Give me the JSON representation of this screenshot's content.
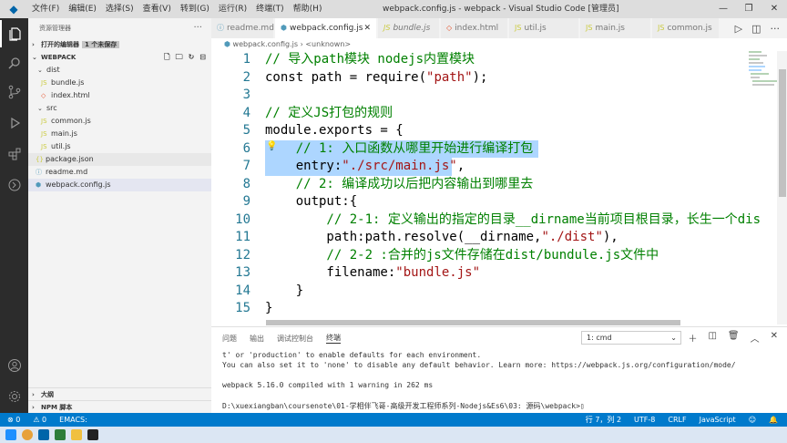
{
  "window": {
    "title": "webpack.config.js - webpack - Visual Studio Code [管理员]",
    "menu": [
      "文件(F)",
      "编辑(E)",
      "选择(S)",
      "查看(V)",
      "转到(G)",
      "运行(R)",
      "终端(T)",
      "帮助(H)"
    ],
    "controls": [
      "—",
      "❐",
      "✕"
    ]
  },
  "sidebar": {
    "header": "资源管理器",
    "open_editors_label": "打开的编辑器",
    "unsaved_badge": "1 个未保存",
    "workspace": "WEBPACK",
    "items": [
      {
        "label": "dist",
        "type": "folder"
      },
      {
        "label": "bundle.js",
        "type": "js"
      },
      {
        "label": "index.html",
        "type": "html"
      },
      {
        "label": "src",
        "type": "folder"
      },
      {
        "label": "common.js",
        "type": "js"
      },
      {
        "label": "main.js",
        "type": "js"
      },
      {
        "label": "util.js",
        "type": "js"
      },
      {
        "label": "package.json",
        "type": "json"
      },
      {
        "label": "readme.md",
        "type": "md"
      },
      {
        "label": "webpack.config.js",
        "type": "js"
      }
    ],
    "outline_label": "大纲",
    "npm_label": "NPM 脚本"
  },
  "tabs": [
    {
      "label": "readme.md",
      "icon": "ⓘ"
    },
    {
      "label": "webpack.config.js",
      "icon": "JS"
    },
    {
      "label": "bundle.js",
      "icon": "JS"
    },
    {
      "label": "index.html",
      "icon": "◇"
    },
    {
      "label": "util.js",
      "icon": "JS"
    },
    {
      "label": "main.js",
      "icon": "JS"
    },
    {
      "label": "common.js",
      "icon": "JS"
    }
  ],
  "breadcrumb": {
    "file": "webpack.config.js",
    "symbol": "<unknown>"
  },
  "editor": {
    "lines": [
      {
        "n": "1",
        "segs": [
          {
            "t": "// 导入path模块 nodejs内置模块",
            "c": "c"
          }
        ]
      },
      {
        "n": "2",
        "segs": [
          {
            "t": "const path = require(",
            "c": ""
          },
          {
            "t": "\"path\"",
            "c": "s"
          },
          {
            "t": ");",
            "c": ""
          }
        ]
      },
      {
        "n": "3",
        "segs": []
      },
      {
        "n": "4",
        "segs": [
          {
            "t": "// 定义JS打包的规则",
            "c": "c"
          }
        ]
      },
      {
        "n": "5",
        "segs": [
          {
            "t": "module.exports = {",
            "c": ""
          }
        ]
      },
      {
        "n": "6",
        "segs": [
          {
            "t": "    // 1: 入口函数从哪里开始进行编译打包",
            "c": "c"
          }
        ]
      },
      {
        "n": "7",
        "segs": [
          {
            "t": "    entry:",
            "c": ""
          },
          {
            "t": "\"./src/main.js\"",
            "c": "s"
          },
          {
            "t": ",",
            "c": ""
          }
        ]
      },
      {
        "n": "8",
        "segs": [
          {
            "t": "    // 2: 编译成功以后把内容输出到哪里去",
            "c": "c"
          }
        ]
      },
      {
        "n": "9",
        "segs": [
          {
            "t": "    output:{",
            "c": ""
          }
        ]
      },
      {
        "n": "10",
        "segs": [
          {
            "t": "        // 2-1: 定义输出的指定的目录__dirname当前项目根目录，长生一个dis",
            "c": "c"
          }
        ]
      },
      {
        "n": "11",
        "segs": [
          {
            "t": "        path:path.resolve(__dirname,",
            "c": ""
          },
          {
            "t": "\"./dist\"",
            "c": "s"
          },
          {
            "t": "),",
            "c": ""
          }
        ]
      },
      {
        "n": "12",
        "segs": [
          {
            "t": "        // 2-2 :合并的js文件存储在dist/bundule.js文件中",
            "c": "c"
          }
        ]
      },
      {
        "n": "13",
        "segs": [
          {
            "t": "        filename:",
            "c": ""
          },
          {
            "t": "\"bundle.js\"",
            "c": "s"
          }
        ]
      },
      {
        "n": "14",
        "segs": [
          {
            "t": "    }",
            "c": ""
          }
        ]
      },
      {
        "n": "15",
        "segs": [
          {
            "t": "}",
            "c": ""
          }
        ]
      }
    ]
  },
  "panel": {
    "tabs": [
      "问题",
      "输出",
      "调试控制台",
      "终端"
    ],
    "terminal_select": "1: cmd",
    "terminal_lines": [
      "t' or 'production' to enable defaults for each environment.",
      "You can also set it to 'none' to disable any default behavior. Learn more: https://webpack.js.org/configuration/mode/",
      "",
      "webpack 5.16.0 compiled with 1 warning in 262 ms",
      "",
      "D:\\xuexiangban\\coursenote\\01-学相伴飞哥-高级开发工程师系列-Nodejs&Es6\\03: 源码\\webpack>▯"
    ]
  },
  "statusbar": {
    "errors": "⊗ 0",
    "warnings": "⚠ 0",
    "emacs": "EMACS:",
    "position": "行 7，列 2",
    "encoding": "UTF-8",
    "eol": "CRLF",
    "language": "JavaScript"
  }
}
